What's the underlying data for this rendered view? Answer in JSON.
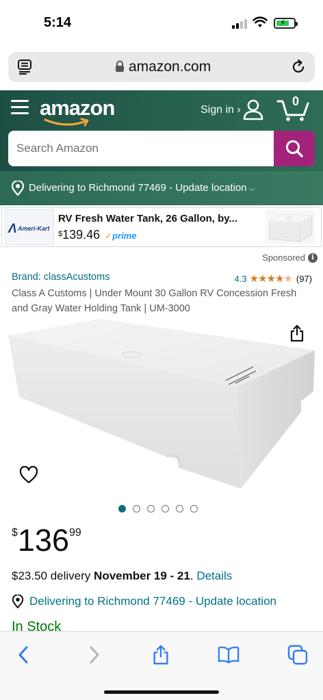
{
  "status_bar": {
    "time": "5:14"
  },
  "browser": {
    "url": "amazon.com"
  },
  "header": {
    "logo": "amazon",
    "sign_in": "Sign in ›",
    "cart_count": "0",
    "search_placeholder": "Search Amazon",
    "delivery": "Delivering to Richmond 77469 - Update location"
  },
  "sponsored_banner": {
    "brand": "Ameri-Kart",
    "title": "RV Fresh Water Tank, 26 Gallon, by...",
    "price_symbol": "$",
    "price": "139.46",
    "prime": "prime"
  },
  "sponsored_label": "Sponsored",
  "product": {
    "brand": "Brand: classAcustoms",
    "rating": "4.3",
    "rating_fraction": 0.86,
    "review_count": "(97)",
    "title": "Class A Customs | Under Mount 30 Gallon RV Concession Fresh and Gray Water Holding Tank | UM-3000",
    "image_count": 6,
    "active_image_index": 0,
    "price_symbol": "$",
    "price_whole": "136",
    "price_fraction": "99",
    "delivery_cost": "$23.50 delivery",
    "delivery_dates": "November 19 - 21",
    "delivery_separator": ".",
    "details_link": "Details",
    "delivering_to": "Delivering to Richmond 77469 - Update location",
    "stock": "In Stock"
  },
  "colors": {
    "header_green": "#27614f",
    "search_button": "#a3237a",
    "link": "#007185",
    "in_stock": "#007600",
    "star": "#de7921",
    "safari_blue": "#2f7bf5"
  },
  "icons": {
    "reader": "reader-icon",
    "lock": "lock-icon",
    "reload": "reload-icon",
    "menu": "hamburger-icon",
    "user": "user-icon",
    "cart": "cart-icon",
    "search": "search-icon",
    "location": "location-pin-icon",
    "share": "share-icon",
    "wishlist": "heart-icon",
    "info": "info-icon"
  }
}
